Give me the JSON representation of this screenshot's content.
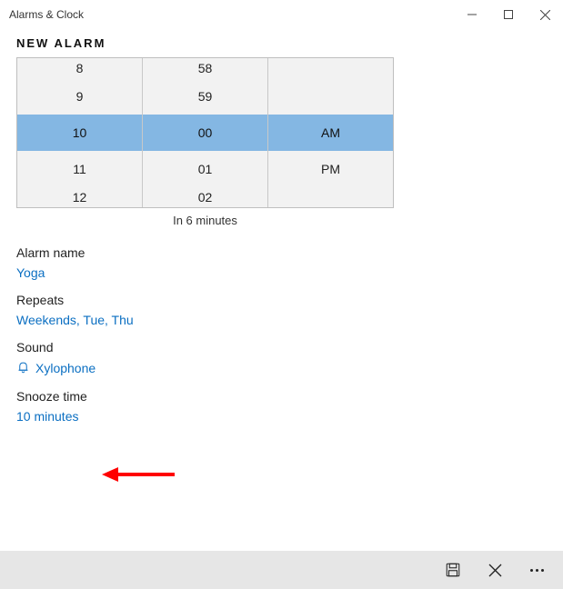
{
  "window": {
    "title": "Alarms & Clock"
  },
  "page": {
    "heading": "NEW ALARM",
    "time_caption": "In 6 minutes"
  },
  "picker": {
    "hours": {
      "minus2": "8",
      "minus1": "9",
      "selected": "10",
      "plus1": "11",
      "plus2": "12"
    },
    "minutes": {
      "minus2": "58",
      "minus1": "59",
      "selected": "00",
      "plus1": "01",
      "plus2": "02"
    },
    "ampm": {
      "selected": "AM",
      "other": "PM"
    }
  },
  "fields": {
    "name_label": "Alarm name",
    "name_value": "Yoga",
    "repeats_label": "Repeats",
    "repeats_value": "Weekends, Tue, Thu",
    "sound_label": "Sound",
    "sound_value": "Xylophone",
    "snooze_label": "Snooze time",
    "snooze_value": "10 minutes"
  },
  "icons": {
    "sound": "bell-icon",
    "save": "save-icon",
    "cancel": "close-icon",
    "more": "ellipsis-icon"
  }
}
